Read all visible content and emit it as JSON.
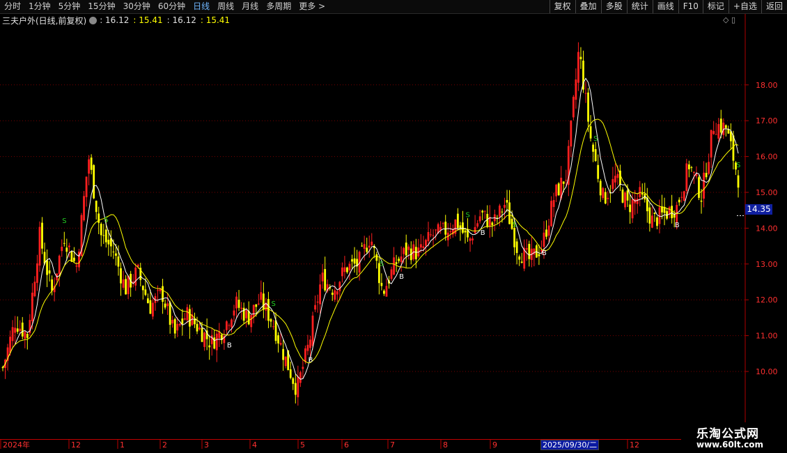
{
  "toolbar": {
    "periods": [
      "分时",
      "1分钟",
      "5分钟",
      "15分钟",
      "30分钟",
      "60分钟",
      "日线",
      "周线",
      "月线",
      "多周期",
      "更多 >"
    ],
    "active_period": "日线",
    "actions": [
      "复权",
      "叠加",
      "多股",
      "统计",
      "画线",
      "F10",
      "标记",
      "+自选",
      "返回"
    ]
  },
  "info": {
    "title": "三夫户外(日线,前复权)",
    "v1": ": 16.12",
    "v2": ": 15.41",
    "v3": ": 16.12",
    "v4": ": 15.41"
  },
  "current_price": "14.35",
  "date_tooltip": "2025/09/30/二",
  "watermark": {
    "line1": "乐淘公式网",
    "line2": "www.60lt.com"
  },
  "colors": {
    "up": "#ff1f1f",
    "down": "#ffff00",
    "grid": "#7a0000",
    "buy": "#ffffff",
    "sell": "#22cc22"
  },
  "chart_data": {
    "type": "candlestick",
    "y_ticks": [
      "10.00",
      "11.00",
      "12.00",
      "13.00",
      "14.00",
      "15.00",
      "16.00",
      "17.00",
      "18.00"
    ],
    "x_ticks": [
      "2024年",
      "12",
      "1",
      "2",
      "3",
      "4",
      "5",
      "6",
      "7",
      "8",
      "9",
      "10",
      "11",
      "12"
    ],
    "series": [
      {
        "name": "MA_fast",
        "color": "#ffffff"
      },
      {
        "name": "MA_slow",
        "color": "#ffff00"
      }
    ],
    "buy_marker": "B",
    "sell_marker": "S",
    "close_path": [
      10.1,
      11.4,
      11.0,
      13.8,
      12.2,
      13.8,
      12.9,
      16.0,
      13.8,
      13.4,
      12.3,
      12.8,
      11.8,
      12.2,
      11.0,
      11.6,
      11.2,
      10.8,
      11.2,
      11.9,
      11.5,
      12.0,
      11.4,
      10.4,
      9.5,
      10.8,
      12.6,
      12.3,
      12.9,
      13.0,
      13.8,
      12.2,
      13.0,
      13.4,
      13.3,
      13.8,
      13.9,
      14.2,
      13.6,
      14.4,
      14.1,
      14.7,
      13.4,
      13.1,
      13.5,
      14.9,
      15.5,
      19.0,
      16.4,
      14.8,
      15.4,
      14.6,
      14.9,
      14.2,
      14.4,
      14.6,
      15.8,
      14.9,
      16.9,
      16.8,
      15.4
    ]
  }
}
